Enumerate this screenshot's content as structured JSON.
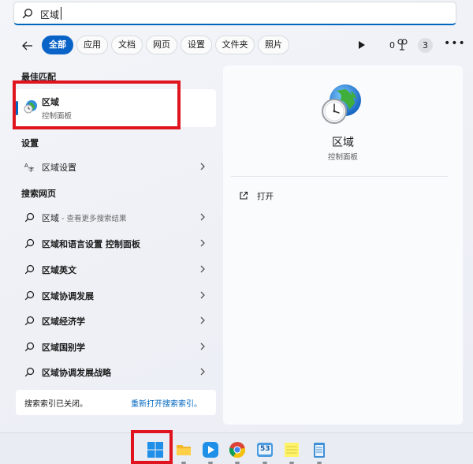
{
  "search": {
    "query": "区域"
  },
  "filters": {
    "chips": [
      "全部",
      "应用",
      "文档",
      "网页",
      "设置",
      "文件夹",
      "照片"
    ],
    "points": "0",
    "badge_count": "3"
  },
  "best_match": {
    "heading": "最佳匹配",
    "name": "区域",
    "subtitle": "控制面板"
  },
  "settings": {
    "heading": "设置",
    "items": [
      {
        "label": "区域设置"
      }
    ]
  },
  "web": {
    "heading": "搜索网页",
    "first": {
      "label": "区域",
      "hint": " - 查看更多搜索结果"
    },
    "items": [
      {
        "label": "区域和语言设置 控制面板"
      },
      {
        "label": "区域英文"
      },
      {
        "label": "区域协调发展"
      },
      {
        "label": "区域经济学"
      },
      {
        "label": "区域国别学"
      },
      {
        "label": "区域协调发展战略"
      }
    ]
  },
  "footer": {
    "text": "搜索索引已关闭。",
    "link": "重新打开搜索索引。"
  },
  "preview": {
    "title": "区域",
    "subtitle": "控制面板",
    "open_label": "打开"
  },
  "taskbar": {
    "icons": [
      "windows-start-icon",
      "file-explorer-icon",
      "tencent-video-icon",
      "chrome-icon",
      "app-53-icon",
      "notes-icon",
      "notepad-icon"
    ],
    "app_53_label": "53"
  },
  "colors": {
    "accent": "#0067c0",
    "chip_active": "#0a64c7",
    "highlight_box": "#e0141e"
  }
}
